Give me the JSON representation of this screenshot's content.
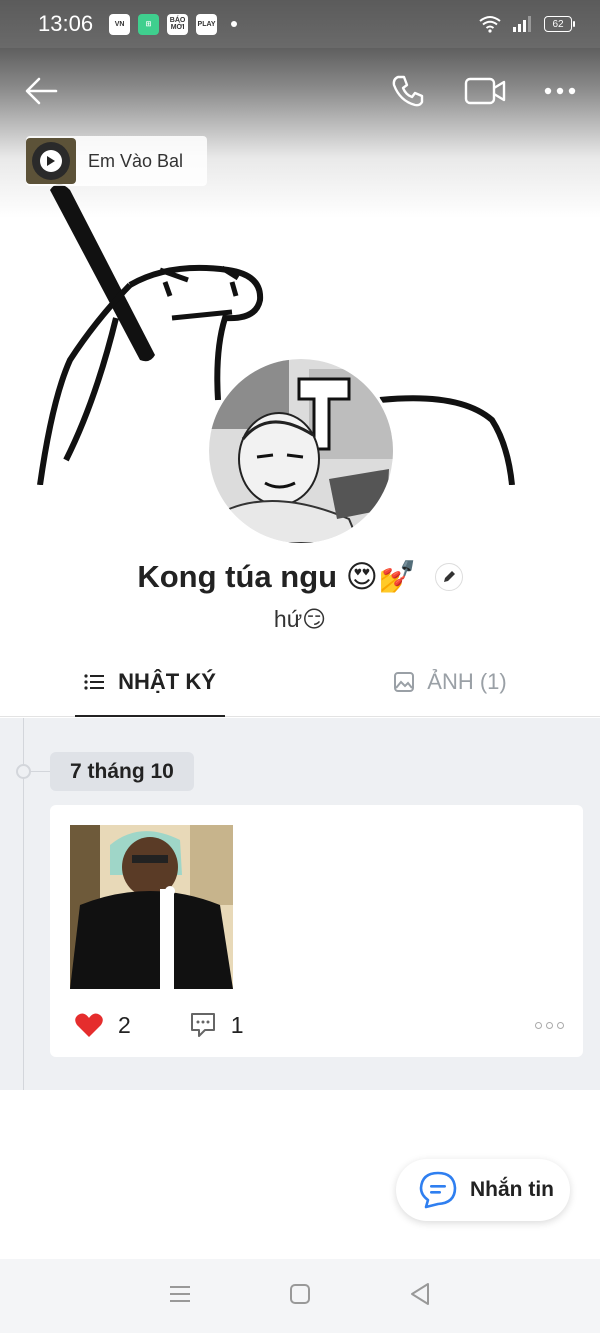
{
  "status_bar": {
    "time": "13:06",
    "apps": [
      {
        "name": "vn-express-app-icon",
        "label": "VN"
      },
      {
        "name": "calendar-app-icon",
        "label": "⊞"
      },
      {
        "name": "bao-moi-app-icon",
        "label": "BÁO MỚI"
      },
      {
        "name": "play-app-icon",
        "label": "PLAY"
      }
    ],
    "battery": "62"
  },
  "music": {
    "title": "Em Vào Bal"
  },
  "profile": {
    "name": "Kong túa ngu 😍💅",
    "status": "hứ😏"
  },
  "tabs": [
    {
      "label": "NHẬT KÝ",
      "active": true
    },
    {
      "label": "ẢNH (1)",
      "active": false
    }
  ],
  "feed": {
    "date": "7 tháng 10",
    "post": {
      "likes": "2",
      "comments": "1"
    }
  },
  "message_button": {
    "label": "Nhắn tin"
  },
  "colors": {
    "accent": "#2f7ff0",
    "like": "#e52d2d",
    "feed_bg": "#eef0f3"
  }
}
